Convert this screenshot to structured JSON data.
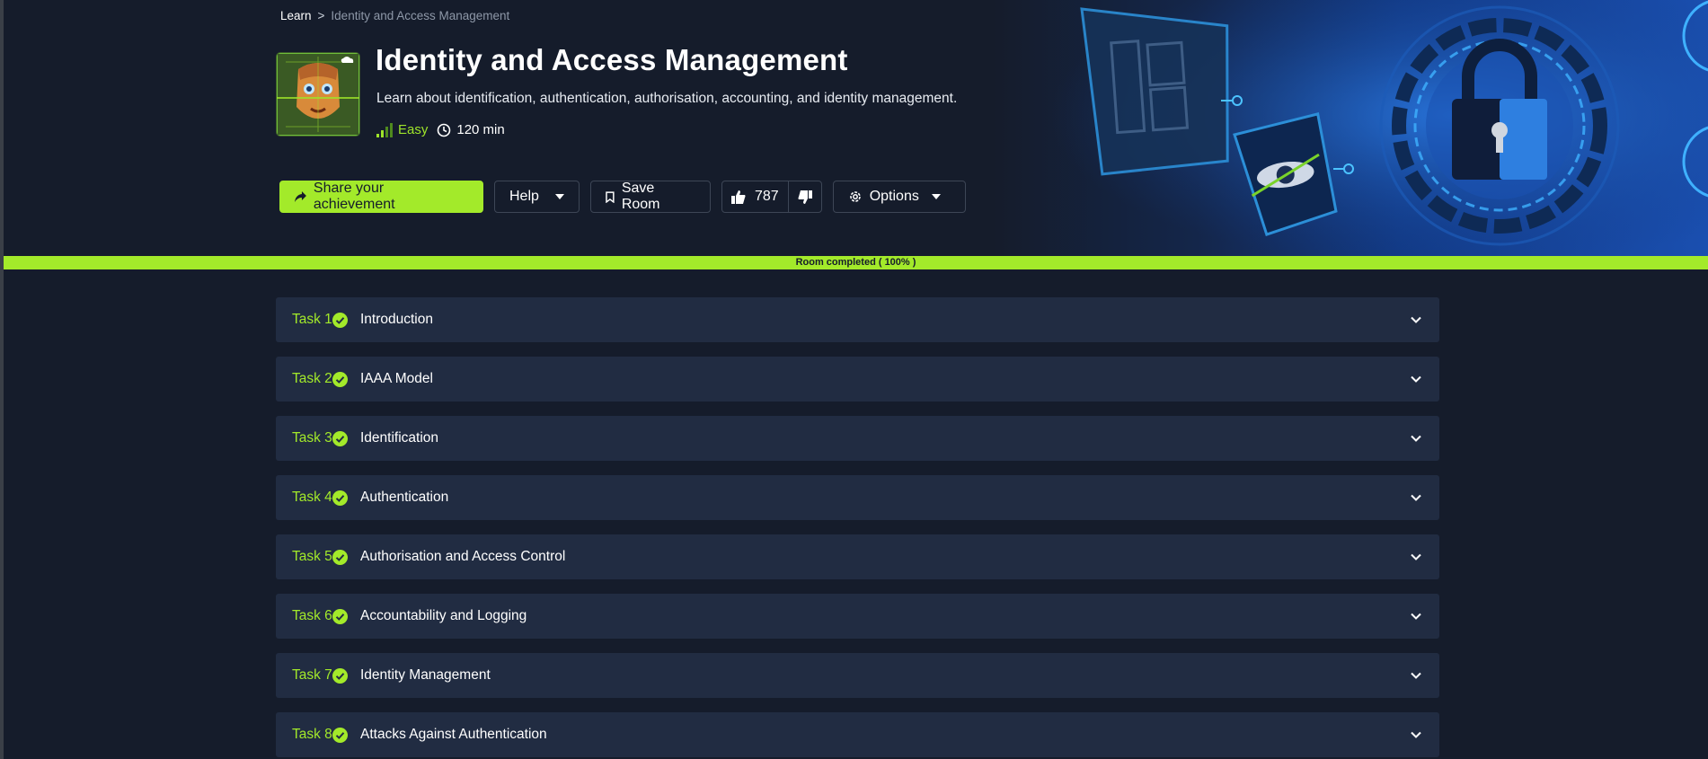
{
  "breadcrumb": {
    "root": "Learn",
    "separator": ">",
    "current": "Identity and Access Management"
  },
  "room": {
    "title": "Identity and Access Management",
    "description": "Learn about identification, authentication, authorisation, accounting, and identity management.",
    "difficulty": "Easy",
    "duration": "120 min"
  },
  "actions": {
    "share": "Share your achievement",
    "help": "Help",
    "save": "Save Room",
    "likes": "787",
    "options": "Options"
  },
  "progress": {
    "label": "Room completed ( 100% )",
    "value": 1.0
  },
  "tasks": [
    {
      "number": "Task 1",
      "title": "Introduction"
    },
    {
      "number": "Task 2",
      "title": "IAAA Model"
    },
    {
      "number": "Task 3",
      "title": "Identification"
    },
    {
      "number": "Task 4",
      "title": "Authentication"
    },
    {
      "number": "Task 5",
      "title": "Authorisation and Access Control"
    },
    {
      "number": "Task 6",
      "title": "Accountability and Logging"
    },
    {
      "number": "Task 7",
      "title": "Identity Management"
    },
    {
      "number": "Task 8",
      "title": "Attacks Against Authentication"
    }
  ],
  "colors": {
    "accent": "#a3ea2a",
    "background": "#151c2b",
    "task_bg": "#212c42"
  }
}
